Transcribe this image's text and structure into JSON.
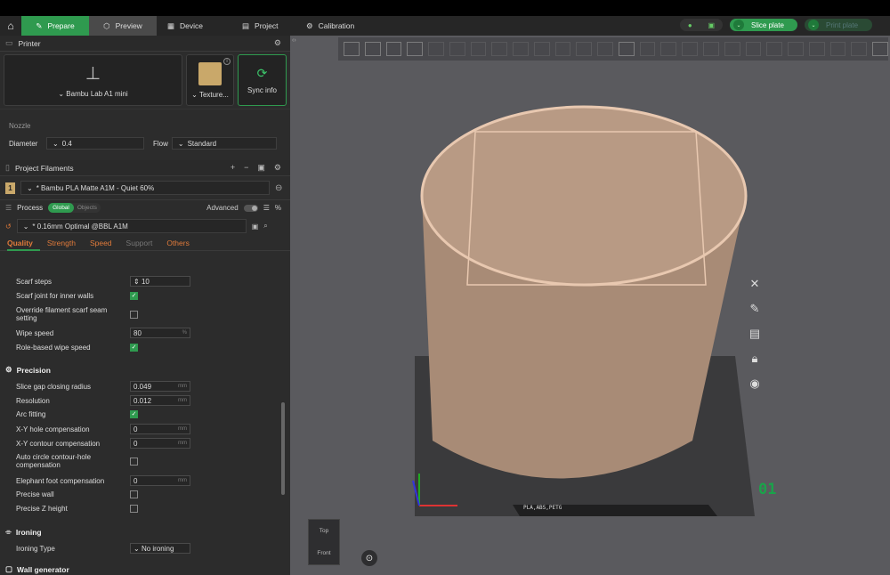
{
  "tabs": {
    "home_icon": "home-icon",
    "prepare": "Prepare",
    "preview": "Preview",
    "device": "Device",
    "project": "Project",
    "calibration": "Calibration"
  },
  "topright": {
    "slice_label": "Slice plate",
    "print_label": "Print plate"
  },
  "printer": {
    "section_title": "Printer",
    "printer_name": "Bambu Lab A1 mini",
    "texture_label": "Texture...",
    "sync_label": "Sync info",
    "nozzle_title": "Nozzle",
    "diameter_label": "Diameter",
    "diameter_value": "0.4",
    "flow_label": "Flow",
    "flow_value": "Standard"
  },
  "filaments": {
    "section_title": "Project Filaments",
    "items": [
      {
        "index": "1",
        "name": "* Bambu PLA Matte A1M - Quiet 60%",
        "color": "#c9a86a"
      }
    ]
  },
  "process": {
    "section_title": "Process",
    "global_label": "Global",
    "objects_label": "Objects",
    "advanced_label": "Advanced",
    "preset": "* 0.16mm Optimal @BBL A1M",
    "tabs": [
      "Quality",
      "Strength",
      "Speed",
      "Support",
      "Others"
    ]
  },
  "settings": {
    "scarf_steps_label": "Scarf steps",
    "scarf_steps_value": "10",
    "scarf_inner_label": "Scarf joint for inner walls",
    "override_scarf_label": "Override filament scarf seam setting",
    "wipe_speed_label": "Wipe speed",
    "wipe_speed_value": "80",
    "wipe_speed_unit": "%",
    "role_wipe_label": "Role-based wipe speed",
    "precision_title": "Precision",
    "slice_gap_label": "Slice gap closing radius",
    "slice_gap_value": "0.049",
    "resolution_label": "Resolution",
    "resolution_value": "0.012",
    "arc_label": "Arc fitting",
    "xy_hole_label": "X-Y hole compensation",
    "xy_hole_value": "0",
    "xy_contour_label": "X-Y contour compensation",
    "xy_contour_value": "0",
    "auto_circle_label": "Auto circle contour-hole compensation",
    "elephant_label": "Elephant foot compensation",
    "elephant_value": "0",
    "precise_wall_label": "Precise wall",
    "precise_z_label": "Precise Z height",
    "ironing_title": "Ironing",
    "ironing_type_label": "Ironing Type",
    "ironing_type_value": "No ironing",
    "wall_gen_title": "Wall generator",
    "unit_mm": "mm"
  },
  "viewport": {
    "plate_number": "01",
    "plate_label": "PLA,ABS,PETG",
    "view_top": "Top",
    "view_front": "Front",
    "object_color": "#a88b76"
  }
}
